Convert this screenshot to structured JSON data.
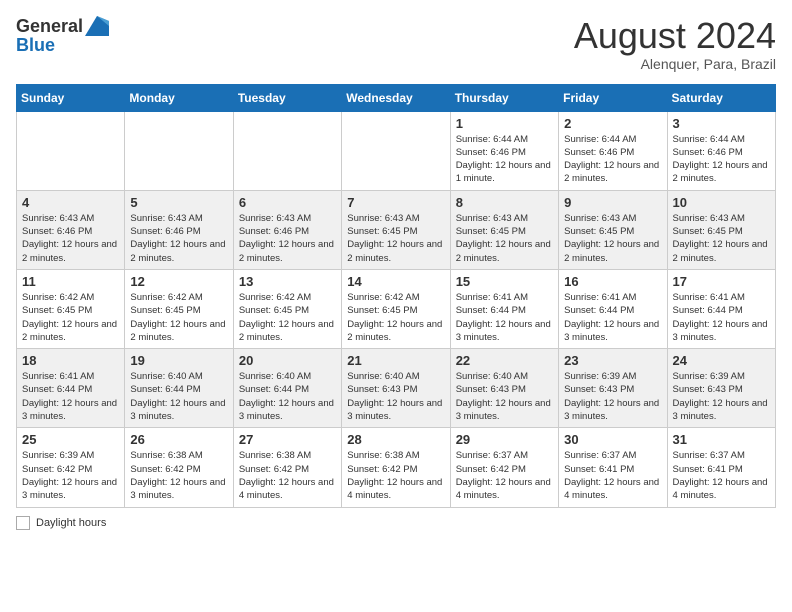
{
  "header": {
    "logo_general": "General",
    "logo_blue": "Blue",
    "month_year": "August 2024",
    "location": "Alenquer, Para, Brazil"
  },
  "days_of_week": [
    "Sunday",
    "Monday",
    "Tuesday",
    "Wednesday",
    "Thursday",
    "Friday",
    "Saturday"
  ],
  "weeks": [
    [
      {
        "day": "",
        "info": ""
      },
      {
        "day": "",
        "info": ""
      },
      {
        "day": "",
        "info": ""
      },
      {
        "day": "",
        "info": ""
      },
      {
        "day": "1",
        "info": "Sunrise: 6:44 AM\nSunset: 6:46 PM\nDaylight: 12 hours and 1 minute."
      },
      {
        "day": "2",
        "info": "Sunrise: 6:44 AM\nSunset: 6:46 PM\nDaylight: 12 hours and 2 minutes."
      },
      {
        "day": "3",
        "info": "Sunrise: 6:44 AM\nSunset: 6:46 PM\nDaylight: 12 hours and 2 minutes."
      }
    ],
    [
      {
        "day": "4",
        "info": "Sunrise: 6:43 AM\nSunset: 6:46 PM\nDaylight: 12 hours and 2 minutes."
      },
      {
        "day": "5",
        "info": "Sunrise: 6:43 AM\nSunset: 6:46 PM\nDaylight: 12 hours and 2 minutes."
      },
      {
        "day": "6",
        "info": "Sunrise: 6:43 AM\nSunset: 6:46 PM\nDaylight: 12 hours and 2 minutes."
      },
      {
        "day": "7",
        "info": "Sunrise: 6:43 AM\nSunset: 6:45 PM\nDaylight: 12 hours and 2 minutes."
      },
      {
        "day": "8",
        "info": "Sunrise: 6:43 AM\nSunset: 6:45 PM\nDaylight: 12 hours and 2 minutes."
      },
      {
        "day": "9",
        "info": "Sunrise: 6:43 AM\nSunset: 6:45 PM\nDaylight: 12 hours and 2 minutes."
      },
      {
        "day": "10",
        "info": "Sunrise: 6:43 AM\nSunset: 6:45 PM\nDaylight: 12 hours and 2 minutes."
      }
    ],
    [
      {
        "day": "11",
        "info": "Sunrise: 6:42 AM\nSunset: 6:45 PM\nDaylight: 12 hours and 2 minutes."
      },
      {
        "day": "12",
        "info": "Sunrise: 6:42 AM\nSunset: 6:45 PM\nDaylight: 12 hours and 2 minutes."
      },
      {
        "day": "13",
        "info": "Sunrise: 6:42 AM\nSunset: 6:45 PM\nDaylight: 12 hours and 2 minutes."
      },
      {
        "day": "14",
        "info": "Sunrise: 6:42 AM\nSunset: 6:45 PM\nDaylight: 12 hours and 2 minutes."
      },
      {
        "day": "15",
        "info": "Sunrise: 6:41 AM\nSunset: 6:44 PM\nDaylight: 12 hours and 3 minutes."
      },
      {
        "day": "16",
        "info": "Sunrise: 6:41 AM\nSunset: 6:44 PM\nDaylight: 12 hours and 3 minutes."
      },
      {
        "day": "17",
        "info": "Sunrise: 6:41 AM\nSunset: 6:44 PM\nDaylight: 12 hours and 3 minutes."
      }
    ],
    [
      {
        "day": "18",
        "info": "Sunrise: 6:41 AM\nSunset: 6:44 PM\nDaylight: 12 hours and 3 minutes."
      },
      {
        "day": "19",
        "info": "Sunrise: 6:40 AM\nSunset: 6:44 PM\nDaylight: 12 hours and 3 minutes."
      },
      {
        "day": "20",
        "info": "Sunrise: 6:40 AM\nSunset: 6:44 PM\nDaylight: 12 hours and 3 minutes."
      },
      {
        "day": "21",
        "info": "Sunrise: 6:40 AM\nSunset: 6:43 PM\nDaylight: 12 hours and 3 minutes."
      },
      {
        "day": "22",
        "info": "Sunrise: 6:40 AM\nSunset: 6:43 PM\nDaylight: 12 hours and 3 minutes."
      },
      {
        "day": "23",
        "info": "Sunrise: 6:39 AM\nSunset: 6:43 PM\nDaylight: 12 hours and 3 minutes."
      },
      {
        "day": "24",
        "info": "Sunrise: 6:39 AM\nSunset: 6:43 PM\nDaylight: 12 hours and 3 minutes."
      }
    ],
    [
      {
        "day": "25",
        "info": "Sunrise: 6:39 AM\nSunset: 6:42 PM\nDaylight: 12 hours and 3 minutes."
      },
      {
        "day": "26",
        "info": "Sunrise: 6:38 AM\nSunset: 6:42 PM\nDaylight: 12 hours and 3 minutes."
      },
      {
        "day": "27",
        "info": "Sunrise: 6:38 AM\nSunset: 6:42 PM\nDaylight: 12 hours and 4 minutes."
      },
      {
        "day": "28",
        "info": "Sunrise: 6:38 AM\nSunset: 6:42 PM\nDaylight: 12 hours and 4 minutes."
      },
      {
        "day": "29",
        "info": "Sunrise: 6:37 AM\nSunset: 6:42 PM\nDaylight: 12 hours and 4 minutes."
      },
      {
        "day": "30",
        "info": "Sunrise: 6:37 AM\nSunset: 6:41 PM\nDaylight: 12 hours and 4 minutes."
      },
      {
        "day": "31",
        "info": "Sunrise: 6:37 AM\nSunset: 6:41 PM\nDaylight: 12 hours and 4 minutes."
      }
    ]
  ],
  "legend": {
    "box_label": "Daylight hours"
  }
}
